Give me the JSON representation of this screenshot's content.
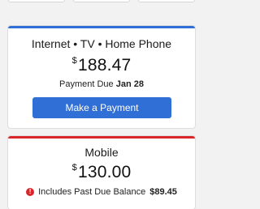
{
  "colors": {
    "internet_accent": "#2f6fd6",
    "mobile_accent": "#d9262b",
    "button_bg": "#2f6fd6"
  },
  "internet_card": {
    "title": "Internet • TV • Home Phone",
    "currency": "$",
    "amount": "188.47",
    "due_label": "Payment Due",
    "due_date": "Jan 28",
    "button_label": "Make a Payment"
  },
  "mobile_card": {
    "title": "Mobile",
    "currency": "$",
    "amount": "130.00",
    "alert_icon": "alert-circle-icon",
    "alert_text": "Includes Past Due Balance",
    "alert_amount": "$89.45"
  }
}
